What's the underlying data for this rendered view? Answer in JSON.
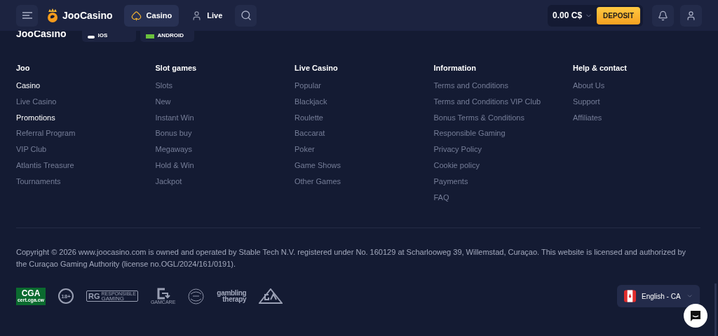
{
  "header": {
    "brand": "JooCasino",
    "nav": [
      {
        "label": "Casino",
        "kind": "cards",
        "selected": true
      },
      {
        "label": "Live",
        "kind": "live",
        "selected": false
      }
    ],
    "balance": "0.00 C$",
    "deposit": "DEPOSIT"
  },
  "app_strip": {
    "brand": "JooCasino",
    "apps": [
      {
        "label": "IOS",
        "kind": "apple"
      },
      {
        "label": "ANDROID",
        "kind": "android"
      }
    ]
  },
  "columns": [
    {
      "title": "Joo",
      "links": [
        {
          "label": "Casino",
          "highlighted": true
        },
        {
          "label": "Live Casino",
          "highlighted": false
        },
        {
          "label": "Promotions",
          "highlighted": true
        },
        {
          "label": "Referral Program",
          "highlighted": false
        },
        {
          "label": "VIP Club",
          "highlighted": false
        },
        {
          "label": "Atlantis Treasure",
          "highlighted": false
        },
        {
          "label": "Tournaments",
          "highlighted": false
        }
      ]
    },
    {
      "title": "Slot games",
      "links": [
        {
          "label": "Slots",
          "highlighted": false
        },
        {
          "label": "New",
          "highlighted": false
        },
        {
          "label": "Instant Win",
          "highlighted": false
        },
        {
          "label": "Bonus buy",
          "highlighted": false
        },
        {
          "label": "Megaways",
          "highlighted": false
        },
        {
          "label": "Hold & Win",
          "highlighted": false
        },
        {
          "label": "Jackpot",
          "highlighted": false
        }
      ]
    },
    {
      "title": "Live Casino",
      "links": [
        {
          "label": "Popular",
          "highlighted": false
        },
        {
          "label": "Blackjack",
          "highlighted": false
        },
        {
          "label": "Roulette",
          "highlighted": false
        },
        {
          "label": "Baccarat",
          "highlighted": false
        },
        {
          "label": "Poker",
          "highlighted": false
        },
        {
          "label": "Game Shows",
          "highlighted": false
        },
        {
          "label": "Other Games",
          "highlighted": false
        }
      ]
    },
    {
      "title": "Information",
      "links": [
        {
          "label": "Terms and Conditions",
          "highlighted": false
        },
        {
          "label": "Terms and Conditions VIP Club",
          "highlighted": false
        },
        {
          "label": "Bonus Terms & Conditions",
          "highlighted": false
        },
        {
          "label": "Responsible Gaming",
          "highlighted": false
        },
        {
          "label": "Privacy Policy",
          "highlighted": false
        },
        {
          "label": "Cookie policy",
          "highlighted": false
        },
        {
          "label": "Payments",
          "highlighted": false
        },
        {
          "label": "FAQ",
          "highlighted": false
        }
      ]
    },
    {
      "title": "Help & contact",
      "links": [
        {
          "label": "About Us",
          "highlighted": false
        },
        {
          "label": "Support",
          "highlighted": false
        },
        {
          "label": "Affiliates",
          "highlighted": false
        }
      ]
    }
  ],
  "copyright": "Copyright © 2026 www.joocasino.com is owned and operated by Stable Tech N.V. registered under No. 160129 at Scharlooweg 39, Willemstad, Curaçao. This website is licensed and authorized by the Curaçao Gaming Authority (license no.OGL/2024/161/0191).",
  "badges": [
    {
      "kind": "cga",
      "label": "CGA",
      "sub": "cert.cga.cw"
    },
    {
      "kind": "age",
      "label": "18+"
    },
    {
      "kind": "rg",
      "label": "RG",
      "sub": "RESPONSIBLE",
      "extra": "GAMING"
    },
    {
      "kind": "gamcare",
      "sub": "GAMCARE"
    },
    {
      "kind": "globe"
    },
    {
      "kind": "therapy",
      "label": "gambling",
      "sub": "therapy"
    },
    {
      "kind": "ga"
    }
  ],
  "language": {
    "label": "English - CA"
  }
}
